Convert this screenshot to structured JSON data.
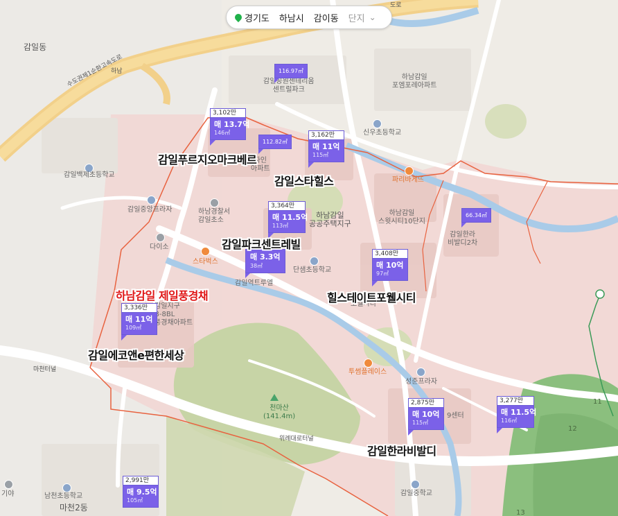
{
  "breadcrumb": {
    "province": "경기도",
    "city": "하남시",
    "dong": "감이동",
    "complex_placeholder": "단지",
    "icons": {
      "location": "location-pin-icon",
      "expand": "chevron-down-icon"
    }
  },
  "colors": {
    "marker": "#7b61e8",
    "area_boundary": "#e8623f",
    "highlight_label": "#e01515"
  },
  "map_labels": {
    "dong_gamil": "감일동",
    "hanam_ic": "하남",
    "expressway": "수도권제1순환고속도로",
    "expressway_top": "도로",
    "gamil_baekje_elem": "감일백제초등학교",
    "gamil_jungang_plaza": "감일중앙프라자",
    "hanam_police": "하남경찰서",
    "gamil_elem": "감일초소",
    "daiso": "다이소",
    "starbucks": "스타벅스",
    "hanam_gamil_district": "하남감일\n공공주택지구",
    "danjem_elem": "단샘초등학교",
    "gamil_yeoktoreul": "감일역트루엘",
    "sinu_elem": "신우초등학교",
    "paris_baguette": "파리바게뜨",
    "hanam_gamil_poem": "하남감일\n포엠포레아파트",
    "hanam_gamil_sweet10": "하남감일\n스윗시티10단지",
    "gamil_hanra2": "감일한라\n비발디2차",
    "gamil_gongwon_central": "감일공원센테리움\n센트럴파크",
    "apt_label": "아파트",
    "apt_label2": "자인\n아파트",
    "gamil_district_b8": "감일지구\nB-8BL\n풍경채아파트",
    "powell_city": "포웰시티",
    "tousplace": "투썸플레이스",
    "seongjun_plaza": "성준프라자",
    "center_9": "9센터",
    "cheonmasan": "천마산\n(141.4m)",
    "wirye_tunnel": "위례대로터널",
    "macheon_tunnel": "마천터널",
    "namcheon_elem": "남천초등학교",
    "macheon2": "마천2동",
    "gamil_middle": "감일중학교",
    "giya": "기야",
    "num_11": "11",
    "num_12": "12",
    "num_13": "13"
  },
  "complexes": [
    {
      "name": "감일푸르지오마크베르",
      "price_per_pyeong": "3,102만",
      "deal": "매 13.7억",
      "area": "146㎡"
    },
    {
      "name": "감일스타힐스",
      "price_per_pyeong": "3,162만",
      "deal": "매 11억",
      "area": "115㎡"
    },
    {
      "name": "감일파크센트레빌",
      "price_per_pyeong": "3,364만",
      "deal": "매 11.5억",
      "area": "113㎡"
    },
    {
      "name": "힐스테이트포웰시티",
      "price_per_pyeong": "3,408만",
      "deal": "매 10억",
      "area": "97㎡"
    },
    {
      "name": "하남감일 제일풍경채",
      "highlight": true
    },
    {
      "name": "감일에코앤e편한세상",
      "price_per_pyeong": "3,336만",
      "deal": "매 11억",
      "area": "109㎡"
    },
    {
      "name": "감일한라비발디",
      "price_per_pyeong": "2,875만",
      "deal": "매 10억",
      "area": "115㎡"
    }
  ],
  "unnamed_markers": [
    {
      "price_per_pyeong": "3,277만",
      "deal": "매 11.5억",
      "area": "116㎡"
    },
    {
      "price_per_pyeong": "2,991만",
      "deal": "매 9.5억",
      "area": "105㎡"
    },
    {
      "deal": "매 3.3억",
      "area": "38㎡"
    }
  ],
  "area_only_markers": [
    "116.97㎡",
    "112.82㎡",
    "66.34㎡"
  ]
}
